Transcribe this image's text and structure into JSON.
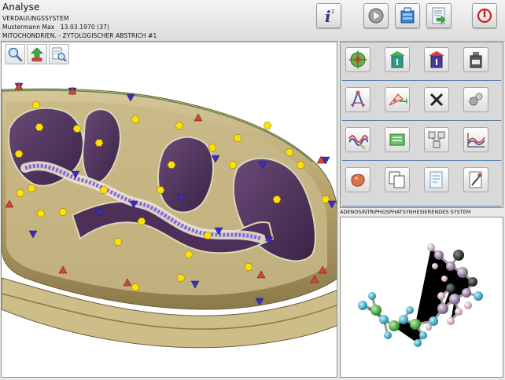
{
  "header": {
    "app_title": "Analyse",
    "system": "VERDAUUNGSSYSTEM",
    "patient_name": "Mustermann Max",
    "patient_dob": "13.03.1970 (37)",
    "sample": "MITOCHONDRIEN. - ZYTOLOGISCHER ABSTRICH #1",
    "info_glyph": "i"
  },
  "toolbar": {
    "buttons": [
      {
        "name": "info-button",
        "icon": "info-icon"
      },
      {
        "name": "play-button",
        "icon": "play-icon"
      },
      {
        "name": "database-button",
        "icon": "database-icon"
      },
      {
        "name": "report-button",
        "icon": "report-icon"
      },
      {
        "name": "stop-button",
        "icon": "power-icon",
        "color": "#d01c1c"
      }
    ]
  },
  "viewer": {
    "tools": [
      "zoom-icon",
      "upload-icon",
      "search-file-icon"
    ],
    "marker_colors": {
      "yellow": "#ffe100",
      "blue_triangle": "#3a2ad0",
      "red_triangle": "#e0402a"
    }
  },
  "side_panel": {
    "tools": [
      "target-icon",
      "funnel-green-icon",
      "funnel-red-icon",
      "bottle-icon",
      "compass-icon",
      "pipette-icon",
      "cross-icon",
      "molecule-icon",
      "wave-icon",
      "recycle-icon",
      "nodes-icon",
      "chart-icon",
      "organ-icon",
      "copy-icon",
      "document-icon",
      "tools-icon"
    ]
  },
  "molecule": {
    "title": "ADENOSINTRIPHOSPHATSYNHESIERENDES SYSTEM"
  }
}
